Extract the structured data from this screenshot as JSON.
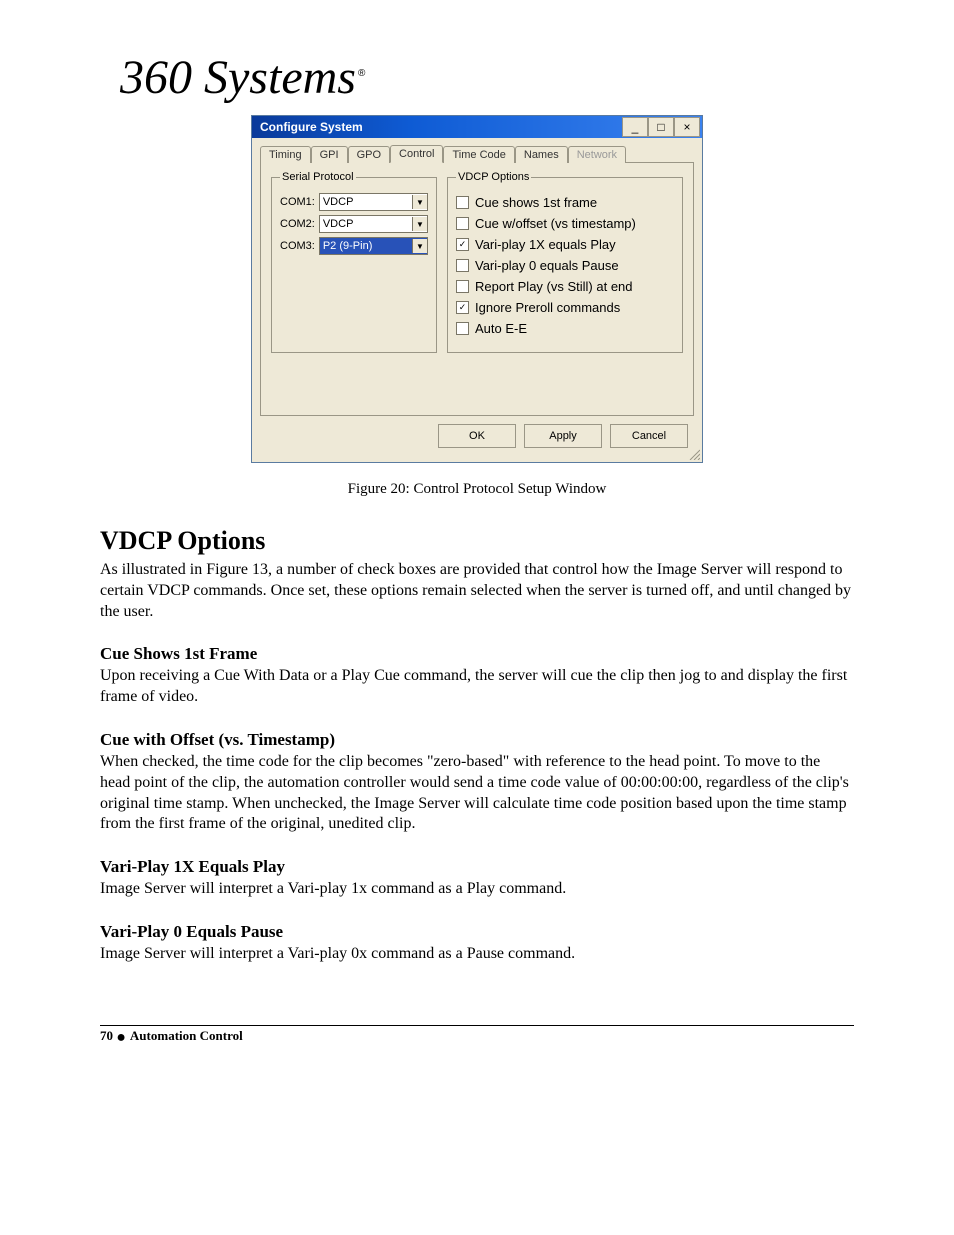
{
  "logo": {
    "text": "360 Systems",
    "trademark": "®"
  },
  "dialog": {
    "title": "Configure System",
    "winbtns": {
      "min": "_",
      "max": "□",
      "close": "×"
    },
    "tabs": [
      "Timing",
      "GPI",
      "GPO",
      "Control",
      "Time Code",
      "Names",
      "Network"
    ],
    "tabs_active_idx": 3,
    "tabs_disabled_idx": [
      6
    ],
    "serial_protocol": {
      "legend": "Serial Protocol",
      "rows": [
        {
          "label": "COM1:",
          "value": "VDCP",
          "selected": false
        },
        {
          "label": "COM2:",
          "value": "VDCP",
          "selected": false
        },
        {
          "label": "COM3:",
          "value": "P2 (9-Pin)",
          "selected": true
        }
      ]
    },
    "vdcp": {
      "legend": "VDCP Options",
      "items": [
        {
          "label": "Cue shows 1st frame",
          "checked": false
        },
        {
          "label": "Cue w/offset (vs timestamp)",
          "checked": false
        },
        {
          "label": "Vari-play 1X equals Play",
          "checked": true
        },
        {
          "label": "Vari-play 0 equals Pause",
          "checked": false
        },
        {
          "label": "Report Play (vs Still) at end",
          "checked": false
        },
        {
          "label": "Ignore Preroll commands",
          "checked": true
        },
        {
          "label": "Auto E-E",
          "checked": false
        }
      ]
    },
    "buttons": {
      "ok": "OK",
      "apply": "Apply",
      "cancel": "Cancel"
    }
  },
  "figure_caption": "Figure 20:  Control Protocol Setup Window",
  "section": {
    "title": "VDCP Options",
    "intro": "As illustrated in Figure 13, a number of check boxes are provided that control how the Image Server will respond to certain VDCP commands.  Once set, these options remain selected when the server is turned off, and until changed by the user.",
    "subs": [
      {
        "title": "Cue Shows 1st Frame",
        "body": "Upon receiving a Cue With Data or a Play Cue command, the server will cue the clip then jog to and display the first frame of video."
      },
      {
        "title": "Cue with Offset (vs. Timestamp)",
        "body": "When checked, the time code for the clip becomes \"zero-based\" with reference to the head point.  To move to the head point of the clip, the automation controller would send a time code value of 00:00:00:00, regardless of the clip's original time stamp.  When unchecked, the Image Server  will calculate time code position based upon the time stamp from the first frame of the original, unedited clip."
      },
      {
        "title": "Vari-Play 1X Equals Play",
        "body": "Image Server will interpret a Vari-play 1x command as a Play command."
      },
      {
        "title": "Vari-Play 0 Equals Pause",
        "body": "Image Server will interpret a Vari-play 0x command as a Pause command."
      }
    ]
  },
  "footer": {
    "page": "70",
    "section": "Automation Control"
  }
}
